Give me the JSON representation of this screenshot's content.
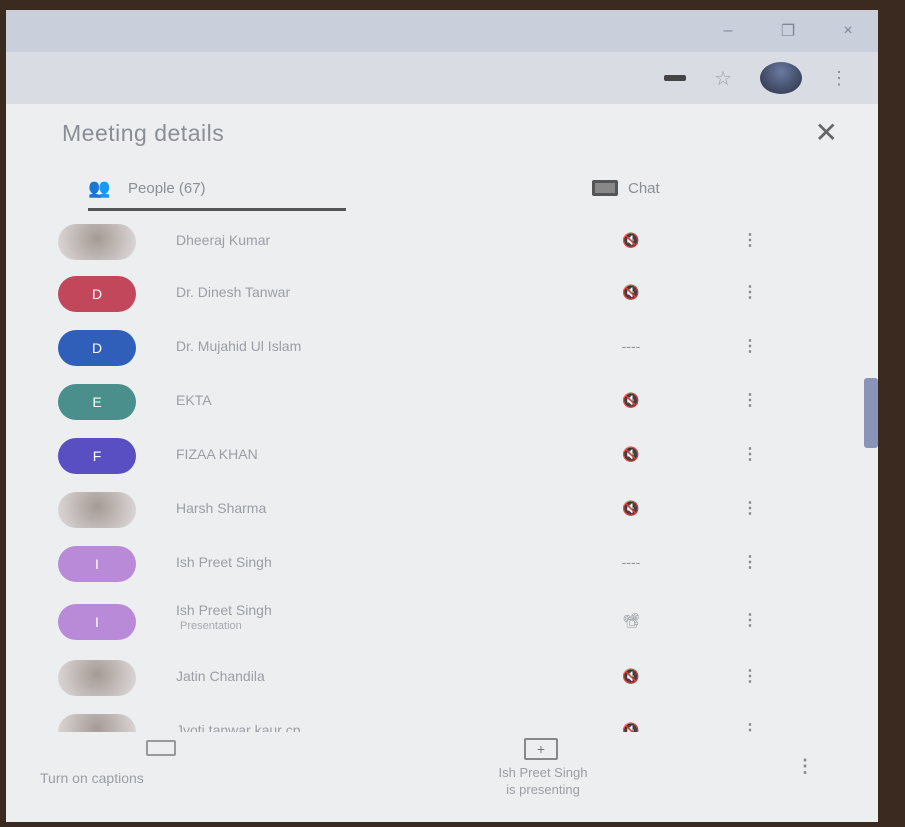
{
  "window": {
    "controls": [
      "–",
      "❐",
      "×"
    ]
  },
  "toolbar": {
    "menu": "⋮"
  },
  "panel": {
    "title": "Meeting details",
    "close": "✕"
  },
  "tabs": {
    "people": "People (67)",
    "chat": "Chat"
  },
  "participants": [
    {
      "name": "Dheeraj Kumar",
      "initial": "",
      "avatar": "photo",
      "status": "mic-off",
      "more": "⋮"
    },
    {
      "name": "Dr. Dinesh Tanwar",
      "initial": "D",
      "avatar": "#c2475a",
      "status": "mic-off",
      "more": "⋮"
    },
    {
      "name": "Dr. Mujahid Ul Islam",
      "initial": "D",
      "avatar": "#2f5fb8",
      "status": "speaking",
      "more": "⋮"
    },
    {
      "name": "EKTA",
      "initial": "E",
      "avatar": "#4a8f8c",
      "status": "mic-off",
      "more": "⋮"
    },
    {
      "name": "FIZAA KHAN",
      "initial": "F",
      "avatar": "#5a4fc2",
      "status": "mic-off",
      "more": "⋮"
    },
    {
      "name": "Harsh Sharma",
      "initial": "",
      "avatar": "photo",
      "status": "mic-off",
      "more": "⋮"
    },
    {
      "name": "Ish Preet Singh",
      "initial": "I",
      "avatar": "#b88ad8",
      "status": "speaking",
      "more": "⋮"
    },
    {
      "name": "Ish Preet Singh",
      "sub": "Presentation",
      "initial": "I",
      "avatar": "#b88ad8",
      "status": "presenting",
      "more": "⋮"
    },
    {
      "name": "Jatin Chandila",
      "initial": "",
      "avatar": "photo",
      "status": "mic-off",
      "more": "⋮"
    },
    {
      "name": "Jyoti tanwar kaur cp",
      "initial": "",
      "avatar": "photo",
      "status": "mic-off",
      "more": "⋮"
    }
  ],
  "status_icons": {
    "mic-off": "🔇",
    "speaking": "----",
    "presenting": "📽"
  },
  "footer": {
    "captions": "Turn on captions",
    "present_line1": "Ish Preet Singh",
    "present_line2": "is presenting",
    "more": "⋮"
  }
}
